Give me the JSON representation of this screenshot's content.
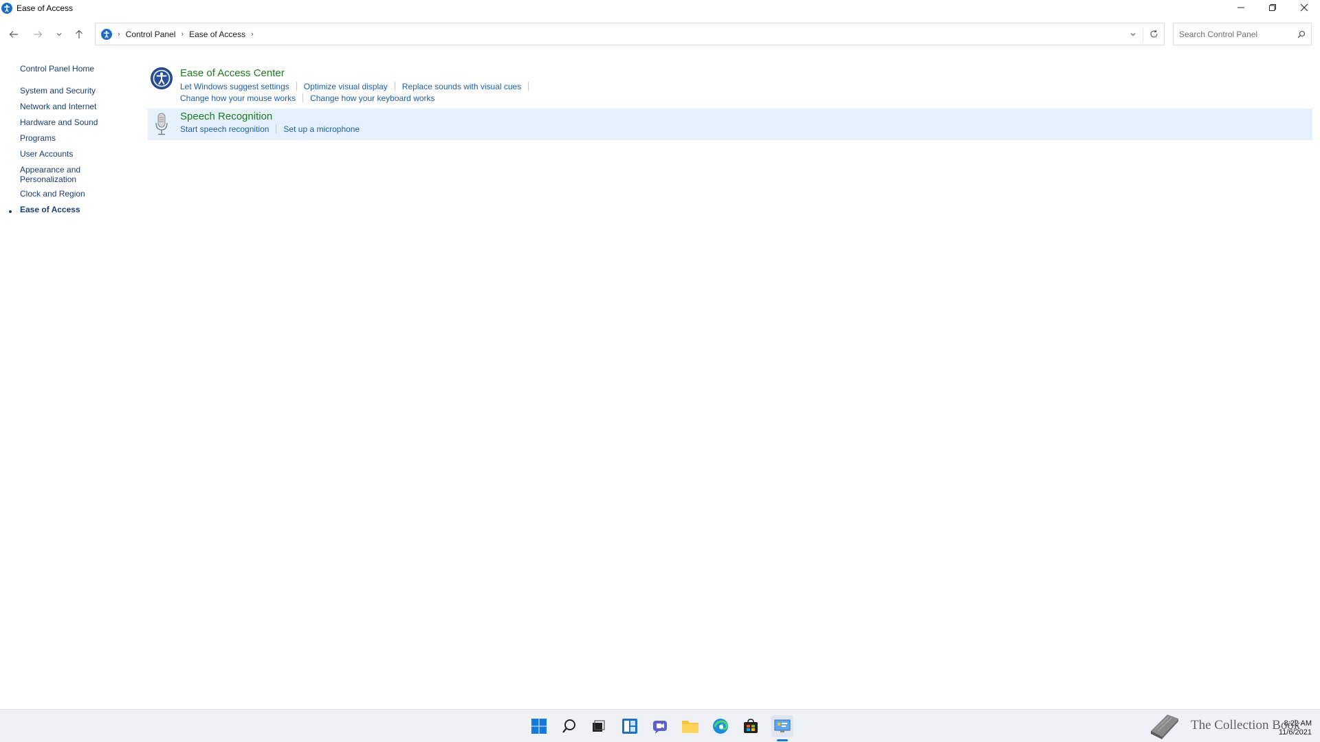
{
  "window": {
    "title": "Ease of Access",
    "controls": [
      "minimize-icon",
      "restore-icon",
      "close-icon"
    ]
  },
  "address_bar": {
    "breadcrumbs": [
      "Control Panel",
      "Ease of Access"
    ],
    "search_placeholder": "Search Control Panel"
  },
  "sidebar": {
    "items": [
      {
        "label": "Control Panel Home"
      },
      {
        "label": "System and Security"
      },
      {
        "label": "Network and Internet"
      },
      {
        "label": "Hardware and Sound"
      },
      {
        "label": "Programs"
      },
      {
        "label": "User Accounts"
      },
      {
        "label": "Appearance and Personalization"
      },
      {
        "label": "Clock and Region"
      },
      {
        "label": "Ease of Access",
        "active": true
      }
    ]
  },
  "categories": [
    {
      "title": "Ease of Access Center",
      "icon": "ease-of-access-icon",
      "links_row1": [
        "Let Windows suggest settings",
        "Optimize visual display",
        "Replace sounds with visual cues"
      ],
      "links_row2": [
        "Change how your mouse works",
        "Change how your keyboard works"
      ]
    },
    {
      "title": "Speech Recognition",
      "icon": "microphone-icon",
      "links_row1": [
        "Start speech recognition",
        "Set up a microphone"
      ]
    }
  ],
  "taskbar": {
    "icons": [
      "start-icon",
      "search-icon",
      "task-view-icon",
      "widgets-icon",
      "chat-icon",
      "file-explorer-icon",
      "edge-icon",
      "store-icon",
      "control-panel-icon"
    ],
    "time": "8:22 AM",
    "date": "11/6/2021",
    "watermark": "The Collection Book"
  },
  "colors": {
    "category_title": "#1d7a1d",
    "link": "#1e5ea8",
    "sidebar_link": "#1a3d74",
    "hover_band": "#e5f1fb",
    "taskbar": "#eef1f6"
  }
}
